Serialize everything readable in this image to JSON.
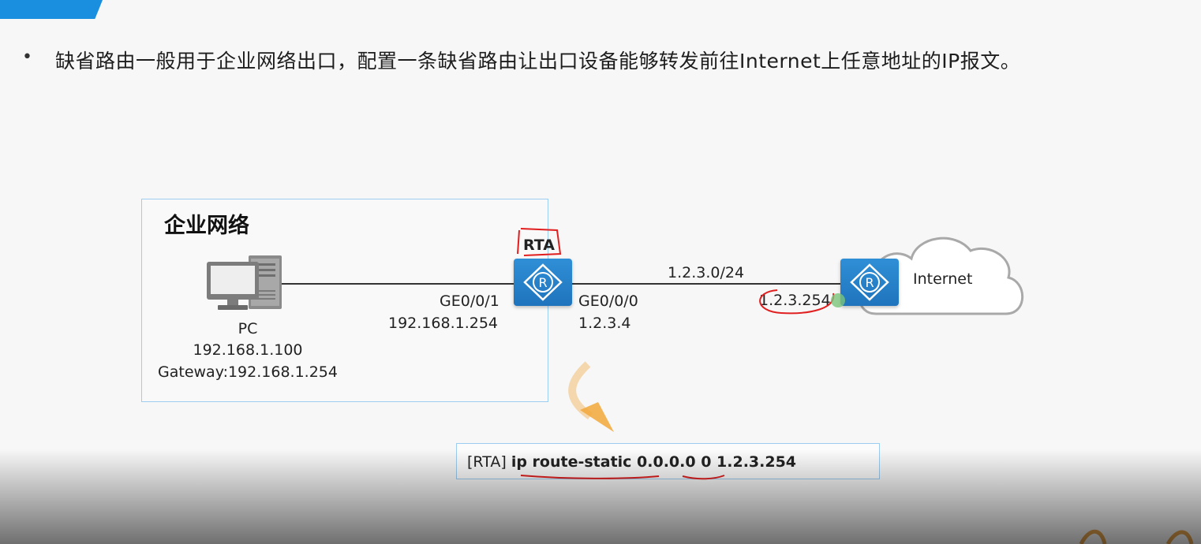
{
  "headline": {
    "bullet": "•",
    "text": "缺省路由一般用于企业网络出口，配置一条缺省路由让出口设备能够转发前往Internet上任意地址的IP报文。"
  },
  "diagram": {
    "enterprise_label": "企业网络",
    "pc": {
      "icon": "pc-icon",
      "name": "PC",
      "ip": "192.168.1.100",
      "gateway": "Gateway:192.168.1.254"
    },
    "rta": {
      "icon": "router-icon",
      "name": "RTA",
      "left_port": "GE0/0/1",
      "left_ip": "192.168.1.254",
      "right_port": "GE0/0/0",
      "right_ip": "1.2.3.4"
    },
    "link": {
      "network": "1.2.3.0/24"
    },
    "isp_router": {
      "icon": "router-icon",
      "ip": "1.2.3.254"
    },
    "cloud": {
      "icon": "cloud-icon",
      "label": "Internet"
    },
    "command": {
      "prefix": "[RTA]",
      "keyword": "ip route-static 0.0.0.0 0 1.2.3.254"
    }
  },
  "colors": {
    "accent_blue": "#1a8fe0",
    "router_blue": "#2f8fd6",
    "box_border": "#9dcdf0",
    "annotation_red": "#e02020",
    "arrow_orange": "#f2a83a"
  }
}
